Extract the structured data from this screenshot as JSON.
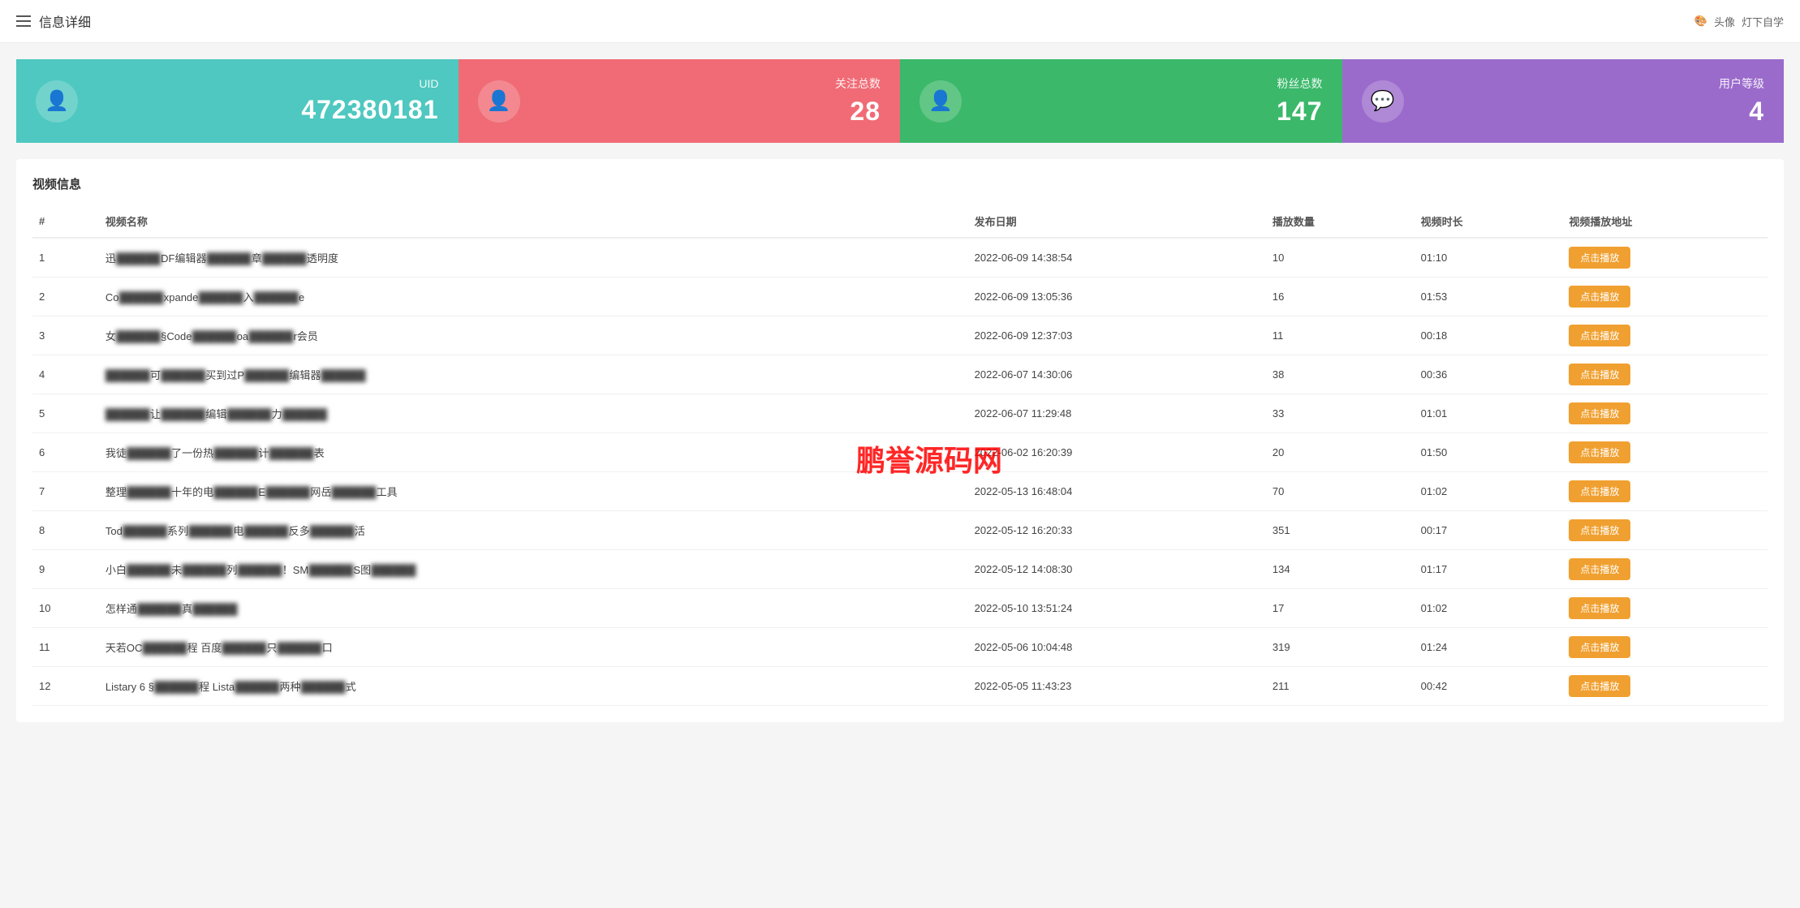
{
  "header": {
    "menu_icon": "☰",
    "title": "信息详细",
    "avatar_label": "头像",
    "user_label": "灯下自学"
  },
  "stats": [
    {
      "id": "uid",
      "label": "UID",
      "value": "472380181",
      "color": "teal",
      "icon": "👤"
    },
    {
      "id": "follows",
      "label": "关注总数",
      "value": "28",
      "color": "red",
      "icon": "👤"
    },
    {
      "id": "fans",
      "label": "粉丝总数",
      "value": "147",
      "color": "green",
      "icon": "👤"
    },
    {
      "id": "level",
      "label": "用户等级",
      "value": "4",
      "color": "purple",
      "icon": "💬"
    }
  ],
  "table": {
    "section_title": "视频信息",
    "columns": [
      "#",
      "视频名称",
      "发布日期",
      "播放数量",
      "视频时长",
      "视频播放地址"
    ],
    "rows": [
      {
        "num": "1",
        "name": "迅...DF编辑器...章...透明度",
        "date": "2022-06-09 14:38:54",
        "plays": "10",
        "duration": "01:10"
      },
      {
        "num": "2",
        "name": "Co...xpande...入...e",
        "date": "2022-06-09 13:05:36",
        "plays": "16",
        "duration": "01:53"
      },
      {
        "num": "3",
        "name": "女...§Code...oa...r会员",
        "date": "2022-06-09 12:37:03",
        "plays": "11",
        "duration": "00:18"
      },
      {
        "num": "4",
        "name": "...可...买到过P...编辑器...",
        "date": "2022-06-07 14:30:06",
        "plays": "38",
        "duration": "00:36"
      },
      {
        "num": "5",
        "name": "...让...编辑...力...",
        "date": "2022-06-07 11:29:48",
        "plays": "33",
        "duration": "01:01"
      },
      {
        "num": "6",
        "name": "我徒...了一份热...计...表",
        "date": "2022-06-02 16:20:39",
        "plays": "20",
        "duration": "01:50"
      },
      {
        "num": "7",
        "name": "整理...十年的电...E...网岳...工具",
        "date": "2022-05-13 16:48:04",
        "plays": "70",
        "duration": "01:02"
      },
      {
        "num": "8",
        "name": "Tod...系列...电...反多...活",
        "date": "2022-05-12 16:20:33",
        "plays": "351",
        "duration": "00:17"
      },
      {
        "num": "9",
        "name": "小白...未...列...！SM...S图...",
        "date": "2022-05-12 14:08:30",
        "plays": "134",
        "duration": "01:17"
      },
      {
        "num": "10",
        "name": "怎样通...真...",
        "date": "2022-05-10 13:51:24",
        "plays": "17",
        "duration": "01:02"
      },
      {
        "num": "11",
        "name": "天若OC...程 百度...只...口",
        "date": "2022-05-06 10:04:48",
        "plays": "319",
        "duration": "01:24"
      },
      {
        "num": "12",
        "name": "Listary 6 §...程 Lista...两种...式",
        "date": "2022-05-05 11:43:23",
        "plays": "211",
        "duration": "00:42"
      }
    ],
    "play_button_label": "点击播放"
  },
  "watermark": "鹏誉源码网"
}
